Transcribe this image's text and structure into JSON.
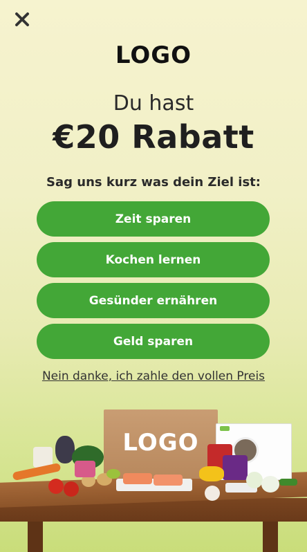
{
  "logo_text": "LOGO",
  "headline": {
    "line1": "Du hast",
    "line2": "€20 Rabatt"
  },
  "question": "Sag uns kurz was dein Ziel ist:",
  "goals": [
    {
      "label": "Zeit sparen"
    },
    {
      "label": "Kochen lernen"
    },
    {
      "label": "Gesünder ernähren"
    },
    {
      "label": "Geld sparen"
    }
  ],
  "decline_link": "Nein danke, ich zahle den vollen Preis",
  "box_logo": "LOGO",
  "colors": {
    "button_green": "#43a737",
    "text_dark": "#1f1f1f"
  },
  "icons": {
    "close": "close-icon"
  }
}
